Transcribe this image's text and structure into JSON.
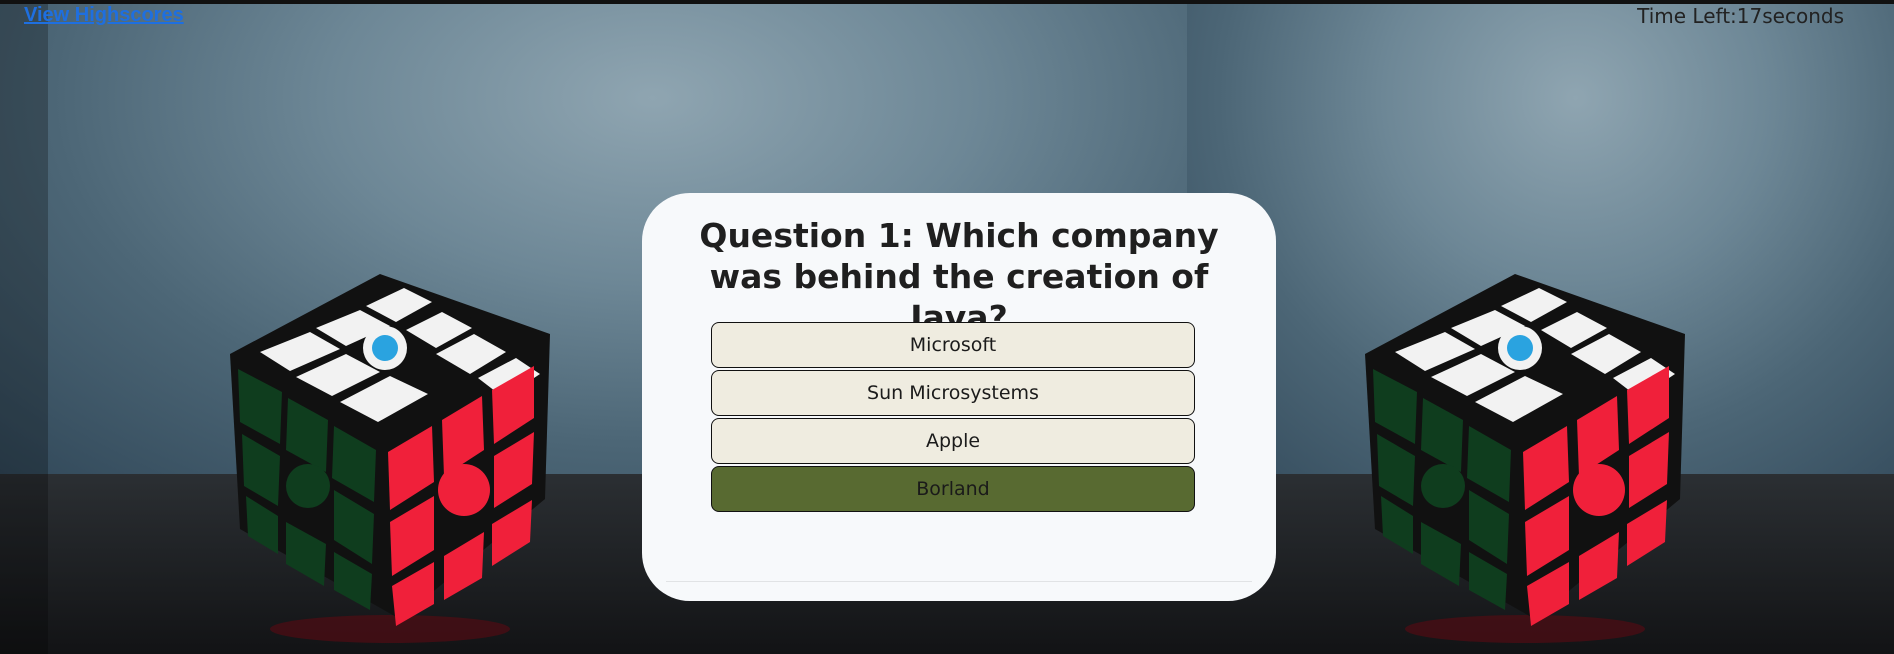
{
  "header": {
    "highscores_link": "View Highscores",
    "timer_label": "Time Left:",
    "timer_value": "17",
    "timer_unit": "seconds"
  },
  "quiz": {
    "question": "Question 1: Which company was behind the creation of Java?",
    "answers": [
      {
        "label": "Microsoft",
        "selected": false
      },
      {
        "label": "Sun Microsystems",
        "selected": false
      },
      {
        "label": "Apple",
        "selected": false
      },
      {
        "label": "Borland",
        "selected": true
      }
    ]
  },
  "colors": {
    "link": "#1e6fe0",
    "card_bg": "#f7f9fb",
    "answer_bg": "#efece0",
    "answer_selected_bg": "#586a31",
    "cube_red": "#f0203a",
    "cube_green": "#0f3d1e",
    "cube_white": "#f2f2f2",
    "logo_blue": "#2aa3e0"
  },
  "background": {
    "image_subject": "rubiks-cube"
  }
}
